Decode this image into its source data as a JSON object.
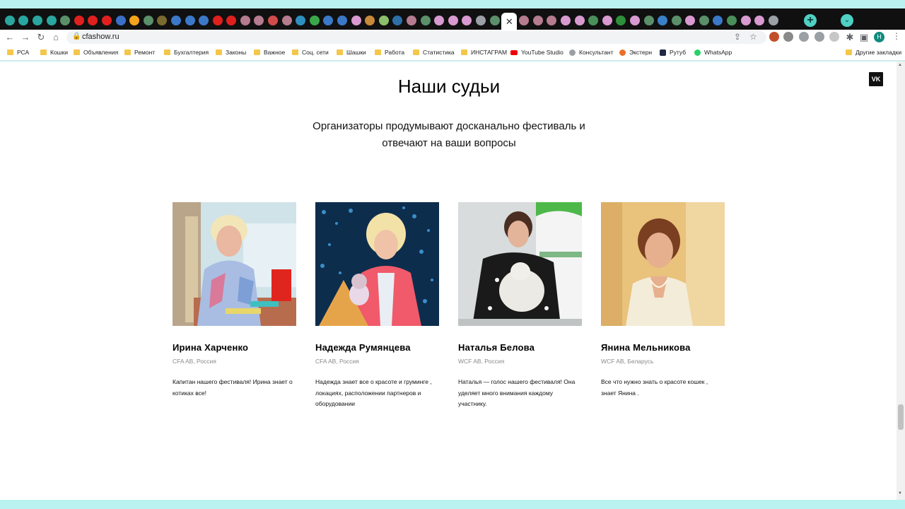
{
  "browser": {
    "url": "cfashow.ru",
    "tab_close": "✕",
    "new_tab": "+",
    "profile_initial": "Н",
    "tab_colors": [
      "#2aa6a0",
      "#2aa6a0",
      "#2aa6a0",
      "#2aa6a0",
      "#5a8f6a",
      "#e0201e",
      "#e0201e",
      "#e0201e",
      "#3a6fc9",
      "#f5a31a",
      "#5a8f6a",
      "#7a6a30",
      "#3b78c8",
      "#3b78c8",
      "#3b78c8",
      "#e0201e",
      "#e0201e",
      "#b57b8f",
      "#b57b8f",
      "#d14b4b",
      "#b57b8f",
      "#2e8fbf",
      "#3aa84a",
      "#3b78c8",
      "#3b78c8",
      "#d89ad0",
      "#c88a3a",
      "#8bbf6a",
      "#2e6fa8",
      "#b57b8f",
      "#5a8f6a",
      "#d89ad0",
      "#d89ad0",
      "#d89ad0",
      "#9aa0a6",
      "#5a8f6a"
    ],
    "tab_colors_after": [
      "#b57b8f",
      "#b57b8f",
      "#b57b8f",
      "#d89ad0",
      "#d89ad0",
      "#4a8f5a",
      "#d89ad0",
      "#2e8f3a",
      "#d89ad0",
      "#5a8f6a",
      "#3a7fc9",
      "#5a8f6a",
      "#d89ad0",
      "#5a8f6a",
      "#3b78c8",
      "#4a8f5a",
      "#d89ad0",
      "#d89ad0",
      "#9aa0a6"
    ]
  },
  "bookmarks": [
    {
      "label": "РСА",
      "icon": "folder-icon"
    },
    {
      "label": "Кошки",
      "icon": "folder-icon"
    },
    {
      "label": "Объявления",
      "icon": "folder-icon"
    },
    {
      "label": "Ремонт",
      "icon": "folder-icon"
    },
    {
      "label": "Бухгалтерия",
      "icon": "folder-icon"
    },
    {
      "label": "Законы",
      "icon": "folder-icon"
    },
    {
      "label": "Важное",
      "icon": "folder-icon"
    },
    {
      "label": "Соц. сети",
      "icon": "folder-icon"
    },
    {
      "label": "Шашки",
      "icon": "folder-icon"
    },
    {
      "label": "Работа",
      "icon": "folder-icon"
    },
    {
      "label": "Статистика",
      "icon": "folder-icon"
    },
    {
      "label": "ИНСТАГРАМ",
      "icon": "folder-icon"
    },
    {
      "label": "YouTube Studio",
      "icon": "youtube-icon"
    },
    {
      "label": "Консультант",
      "icon": "chat-icon"
    },
    {
      "label": "Экстерн",
      "icon": "kontur-icon"
    },
    {
      "label": "Рутуб",
      "icon": "rutube-icon"
    },
    {
      "label": "WhatsApp",
      "icon": "whatsapp-icon"
    }
  ],
  "other_bookmarks": "Другие закладки",
  "page": {
    "vk_label": "VK",
    "title": "Наши судьи",
    "subtitle": "Организаторы продумывают досканально фестиваль и отвечают на ваши вопросы",
    "judges": [
      {
        "name": "Ирина Харченко",
        "meta": "CFA AB, Россия",
        "desc": "Капитан нашего фестиваля! Ирина знает о котиках все!"
      },
      {
        "name": "Надежда Румянцева",
        "meta": "CFA AB, Россия",
        "desc": "Надежда знает все о красоте и груминге , локациях, расположении партнеров и оборудовании"
      },
      {
        "name": "Наталья Белова",
        "meta": "WCF AB, Россия",
        "desc": "Наталья — голос нашего фестиваля! Она уделяет много внимания каждому участнику."
      },
      {
        "name": "Янина Мельникова",
        "meta": "WCF AB, Беларусь",
        "desc": "Все что нужно знать о красоте кошек , знает Янина ."
      }
    ]
  }
}
